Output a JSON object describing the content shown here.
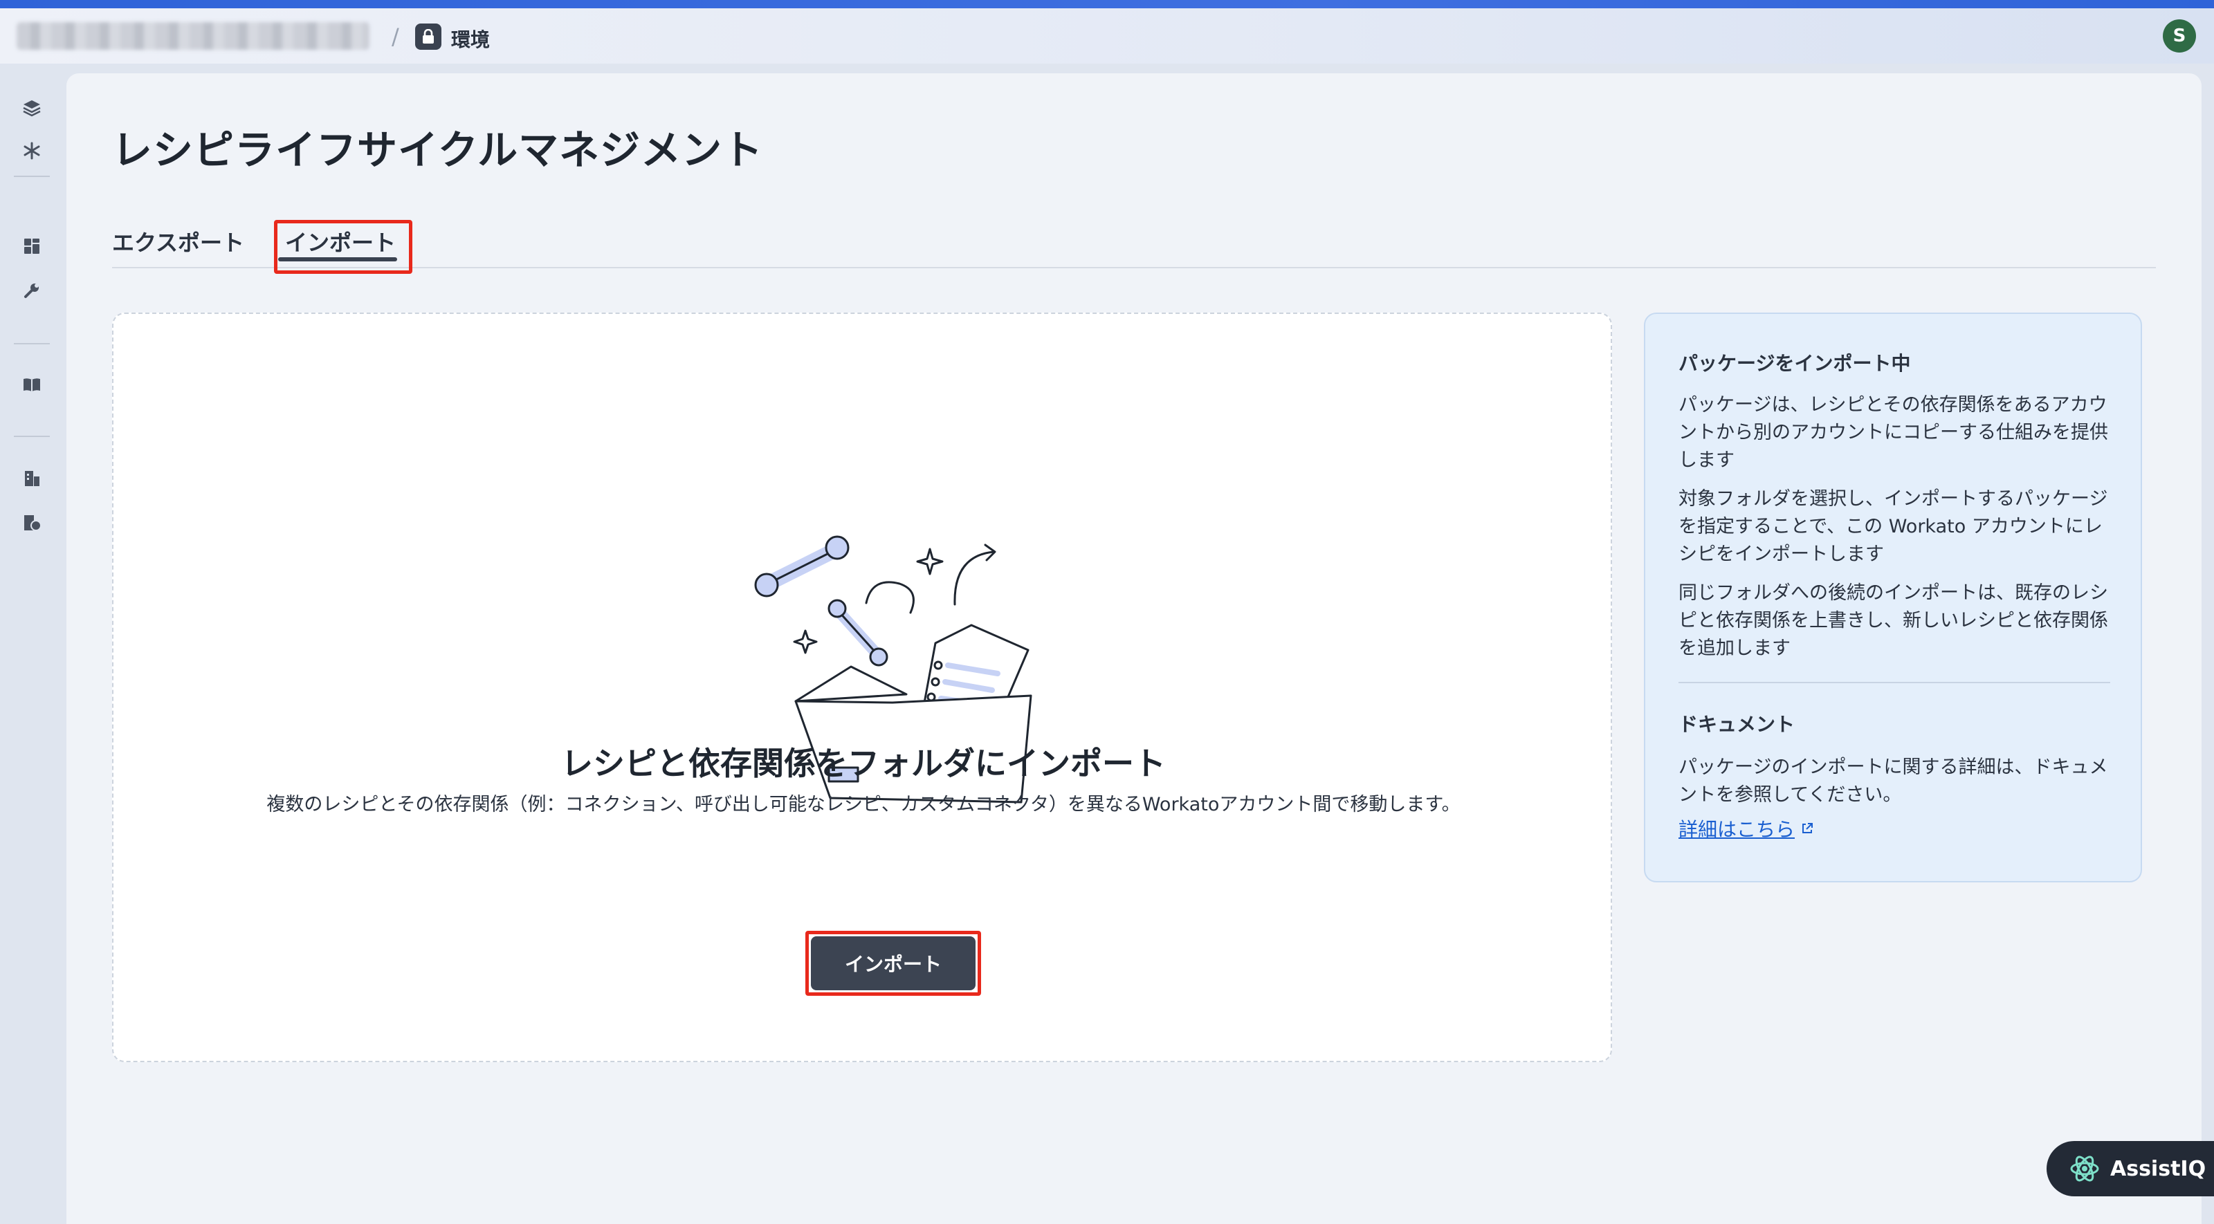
{
  "header": {
    "environment_label": "環境",
    "avatar_initial": "S"
  },
  "page": {
    "title": "レシピライフサイクルマネジメント"
  },
  "tabs": [
    {
      "label": "エクスポート",
      "active": false
    },
    {
      "label": "インポート",
      "active": true
    }
  ],
  "import_card": {
    "title": "レシピと依存関係をフォルダにインポート",
    "description": "複数のレシピとその依存関係（例：コネクション、呼び出し可能なレシピ、カスタムコネクタ）を異なるWorkatoアカウント間で移動します。",
    "button_label": "インポート"
  },
  "info_panel": {
    "heading": "パッケージをインポート中",
    "paragraphs": [
      "パッケージは、レシピとその依存関係をあるアカウントから別のアカウントにコピーする仕組みを提供します",
      "対象フォルダを選択し、インポートするパッケージを指定することで、この Workato アカウントにレシピをインポートします",
      "同じフォルダへの後続のインポートは、既存のレシピと依存関係を上書きし、新しいレシピと依存関係を追加します"
    ],
    "docs_heading": "ドキュメント",
    "docs_text": "パッケージのインポートに関する詳細は、ドキュメントを参照してください。",
    "docs_link": "詳細はこちら"
  },
  "assistant": {
    "label": "AssistIQ"
  },
  "sidebar_icons": [
    "layers-icon",
    "snowflake-icon",
    "dashboard-icon",
    "wrench-icon",
    "book-icon",
    "building-icon",
    "billing-icon"
  ],
  "colors": {
    "highlight": "#e8291c",
    "button": "#3c4452",
    "link": "#1a5fd0",
    "info_bg": "#e4effb"
  }
}
